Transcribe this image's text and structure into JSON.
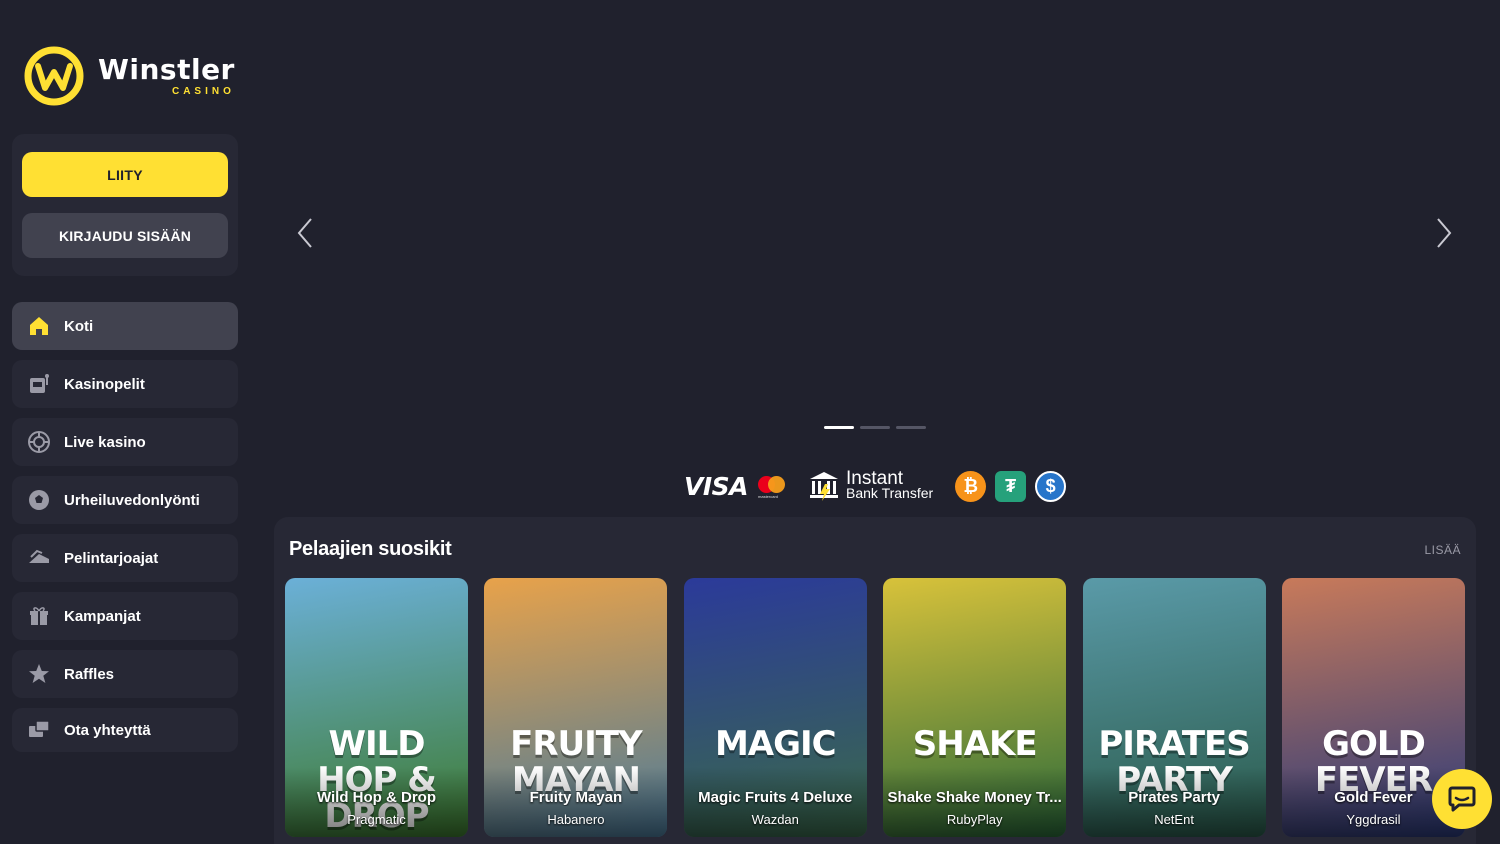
{
  "brand": {
    "name": "Winstler",
    "sub": "CASINO",
    "accent": "#ffe033"
  },
  "auth": {
    "join_label": "LIITY",
    "login_label": "KIRJAUDU SISÄÄN"
  },
  "nav": [
    {
      "label": "Koti",
      "icon": "home-icon",
      "active": true
    },
    {
      "label": "Kasinopelit",
      "icon": "slot-machine-icon"
    },
    {
      "label": "Live kasino",
      "icon": "roulette-icon"
    },
    {
      "label": "Urheiluvedonlyönti",
      "icon": "soccer-ball-icon"
    },
    {
      "label": "Pelintarjoajat",
      "icon": "providers-icon"
    },
    {
      "label": "Kampanjat",
      "icon": "gift-icon"
    },
    {
      "label": "Raffles",
      "icon": "star-icon"
    },
    {
      "label": "Ota yhteyttä",
      "icon": "contact-icon"
    }
  ],
  "carousel": {
    "slide_count": 3,
    "active_slide": 1
  },
  "payments": {
    "visa": "VISA",
    "mastercard_caption": "mastercard",
    "instant_line1": "Instant",
    "instant_line2": "Bank Transfer",
    "btc_symbol": "₿",
    "usdt_symbol": "₮",
    "usdc_symbol": "$"
  },
  "section": {
    "title": "Pelaajien suosikit",
    "more_label": "LISÄÄ",
    "games": [
      {
        "art_title": "WILD HOP & DROP",
        "name": "Wild Hop & Drop",
        "provider": "Pragmatic",
        "colors": [
          "#6bb0d8",
          "#3d7a2e"
        ]
      },
      {
        "art_title": "FRUITY MAYAN",
        "name": "Fruity Mayan",
        "provider": "Habanero",
        "colors": [
          "#e8a24a",
          "#4a7a9a"
        ]
      },
      {
        "art_title": "MAGIC",
        "name": "Magic Fruits 4 Deluxe",
        "provider": "Wazdan",
        "colors": [
          "#2b3a9a",
          "#3a6a4a"
        ]
      },
      {
        "art_title": "SHAKE",
        "name": "Shake Shake Money Tr...",
        "provider": "RubyPlay",
        "colors": [
          "#d8c23a",
          "#2a6a3a"
        ]
      },
      {
        "art_title": "PIRATES PARTY",
        "name": "Pirates Party",
        "provider": "NetEnt",
        "colors": [
          "#5a9aa8",
          "#2a5a4a"
        ]
      },
      {
        "art_title": "GOLD FEVER",
        "name": "Gold Fever",
        "provider": "Yggdrasil",
        "colors": [
          "#c87a5a",
          "#2a3a7a"
        ]
      }
    ]
  }
}
